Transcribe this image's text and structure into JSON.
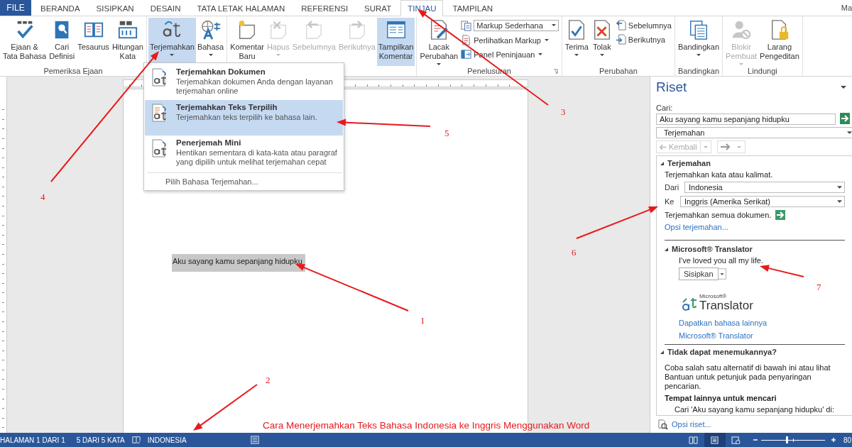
{
  "tabs": [
    {
      "label": "FILE",
      "kind": "file",
      "selected": false
    },
    {
      "label": "BERANDA",
      "kind": "tab",
      "selected": false
    },
    {
      "label": "SISIPKAN",
      "kind": "tab",
      "selected": false
    },
    {
      "label": "DESAIN",
      "kind": "tab",
      "selected": false
    },
    {
      "label": "TATA LETAK HALAMAN",
      "kind": "tab",
      "selected": false
    },
    {
      "label": "REFERENSI",
      "kind": "tab",
      "selected": false
    },
    {
      "label": "SURAT",
      "kind": "tab",
      "selected": false
    },
    {
      "label": "TINJAU",
      "kind": "tab",
      "selected": true
    },
    {
      "label": "TAMPILAN",
      "kind": "tab",
      "selected": false
    }
  ],
  "account": "Ma",
  "ribbon": [
    {
      "label": "Pemeriksa Ejaan",
      "items": [
        {
          "kind": "big",
          "label": "Ejaan &\nTata Bahasa",
          "disabled": false,
          "selected": false
        },
        {
          "kind": "big",
          "label": "Cari\nDefinisi",
          "disabled": false,
          "selected": false
        },
        {
          "kind": "big",
          "label": "Tesaurus",
          "disabled": false,
          "selected": false
        },
        {
          "kind": "big",
          "label": "Hitungan\nKata",
          "disabled": false,
          "selected": false
        }
      ]
    },
    {
      "items": [
        {
          "kind": "big",
          "label": "Terjemahkan",
          "dropdown": true,
          "disabled": false,
          "selected": true
        },
        {
          "kind": "big",
          "label": "Bahasa",
          "dropdown": true,
          "disabled": false,
          "selected": false
        }
      ]
    },
    {
      "items": [
        {
          "kind": "big",
          "label": "Komentar\nBaru",
          "disabled": false,
          "selected": false
        },
        {
          "kind": "big",
          "label": "Hapus",
          "dropdown": true,
          "disabled": true,
          "selected": false
        },
        {
          "kind": "big",
          "label": "Sebelumnya",
          "disabled": true,
          "selected": false
        },
        {
          "kind": "big",
          "label": "Berikutnya",
          "disabled": true,
          "selected": false
        },
        {
          "kind": "big",
          "label": "Tampilkan\nKomentar",
          "disabled": false,
          "selected": true
        }
      ]
    },
    {
      "label": "Penelusuran",
      "launcher": true,
      "items": [
        {
          "kind": "big",
          "label": "Lacak\nPerubahan",
          "dropdown": true,
          "disabled": false,
          "selected": false
        },
        {
          "kind": "stack",
          "items": [
            {
              "kind": "combo",
              "label": "Markup Sederhana",
              "dropdown": true,
              "disabled": false
            },
            {
              "kind": "small",
              "label": "Perlihatkan Markup",
              "dropdown": true,
              "disabled": false
            },
            {
              "kind": "small",
              "label": "Panel Peninjauan",
              "dropdown": true,
              "disabled": false
            }
          ]
        }
      ]
    },
    {
      "label": "Perubahan",
      "items": [
        {
          "kind": "big",
          "label": "Terima",
          "dropdown": true,
          "disabled": false,
          "selected": false
        },
        {
          "kind": "big",
          "label": "Tolak",
          "dropdown": true,
          "disabled": false,
          "selected": false
        },
        {
          "kind": "stack",
          "items": [
            {
              "kind": "small",
              "label": "Sebelumnya",
              "disabled": false
            },
            {
              "kind": "small",
              "label": "Berikutnya",
              "disabled": false
            }
          ]
        }
      ]
    },
    {
      "label": "Bandingkan",
      "items": [
        {
          "kind": "big",
          "label": "Bandingkan",
          "dropdown": true,
          "disabled": false,
          "selected": false
        }
      ]
    },
    {
      "label": "Lindungi",
      "items": [
        {
          "kind": "big",
          "label": "Blokir\nPembuat",
          "dropdown": true,
          "disabled": true,
          "selected": false
        },
        {
          "kind": "big",
          "label": "Larang\nPengeditan",
          "disabled": false,
          "selected": false
        }
      ]
    }
  ],
  "translate_menu": {
    "items": [
      {
        "title": "Terjemahkan Dokumen",
        "description": "Terjemahkan dokumen Anda dengan layanan terjemahan online",
        "selected": false
      },
      {
        "title": "Terjemahkan Teks Terpilih",
        "description": "Terjemahkan teks terpilih ke bahasa lain.",
        "selected": true
      },
      {
        "title": "Penerjemah Mini",
        "description": "Hentikan sementara di kata-kata atau paragraf yang dipilih untuk melihat terjemahan cepat",
        "selected": false
      }
    ],
    "footer": "Pilih Bahasa Terjemahan..."
  },
  "document": {
    "selected_text": "Aku sayang kamu sepanjang hidupku"
  },
  "research_pane": {
    "title": "Riset",
    "search_label": "Cari:",
    "search_value": "Aku sayang kamu sepanjang hidupku",
    "source": "Terjemahan",
    "back": "Kembali",
    "translation": {
      "heading": "Terjemahan",
      "expanded": true,
      "intro": "Terjemahkan kata atau kalimat.",
      "from_label": "Dari",
      "from": "Indonesia",
      "to_label": "Ke",
      "to": "Inggris (Amerika Serikat)",
      "translate_all": "Terjemahkan semua dokumen.",
      "options_link": "Opsi terjemahan..."
    },
    "translator": {
      "heading": "Microsoft® Translator",
      "expanded": true,
      "result": "I've loved you all my life.",
      "insert": "Sisipkan",
      "logo_small": "Microsoft®",
      "logo": "Translator",
      "links": [
        "Dapatkan bahasa lainnya",
        "Microsoft® Translator"
      ]
    },
    "not_found": {
      "heading": "Tidak dapat menemukannya?",
      "expanded": true,
      "text": "Coba salah satu alternatif di bawah ini atau lihat Bantuan untuk petunjuk pada penyaringan pencarian.",
      "other_heading": "Tempat lainnya untuk mencari",
      "other_text": "Cari 'Aku sayang kamu sepanjang hidupku' di:"
    },
    "footer_link": "Opsi riset..."
  },
  "status_bar": {
    "page": "HALAMAN 1 DARI 1",
    "words": "5 DARI 5 KATA",
    "language": "INDONESIA",
    "views": [
      {
        "selected": false
      },
      {
        "selected": true
      },
      {
        "selected": false
      }
    ],
    "zoom": {
      "level": 0.4
    },
    "zoom_text": "80"
  },
  "annotations": [
    {
      "number": "1"
    },
    {
      "number": "2"
    },
    {
      "number": "3"
    },
    {
      "number": "4"
    },
    {
      "number": "5"
    },
    {
      "number": "6"
    },
    {
      "number": "7"
    }
  ],
  "caption": "Cara Menerjemahkan Teks Bahasa Indonesia ke Inggris Menggunakan Word"
}
